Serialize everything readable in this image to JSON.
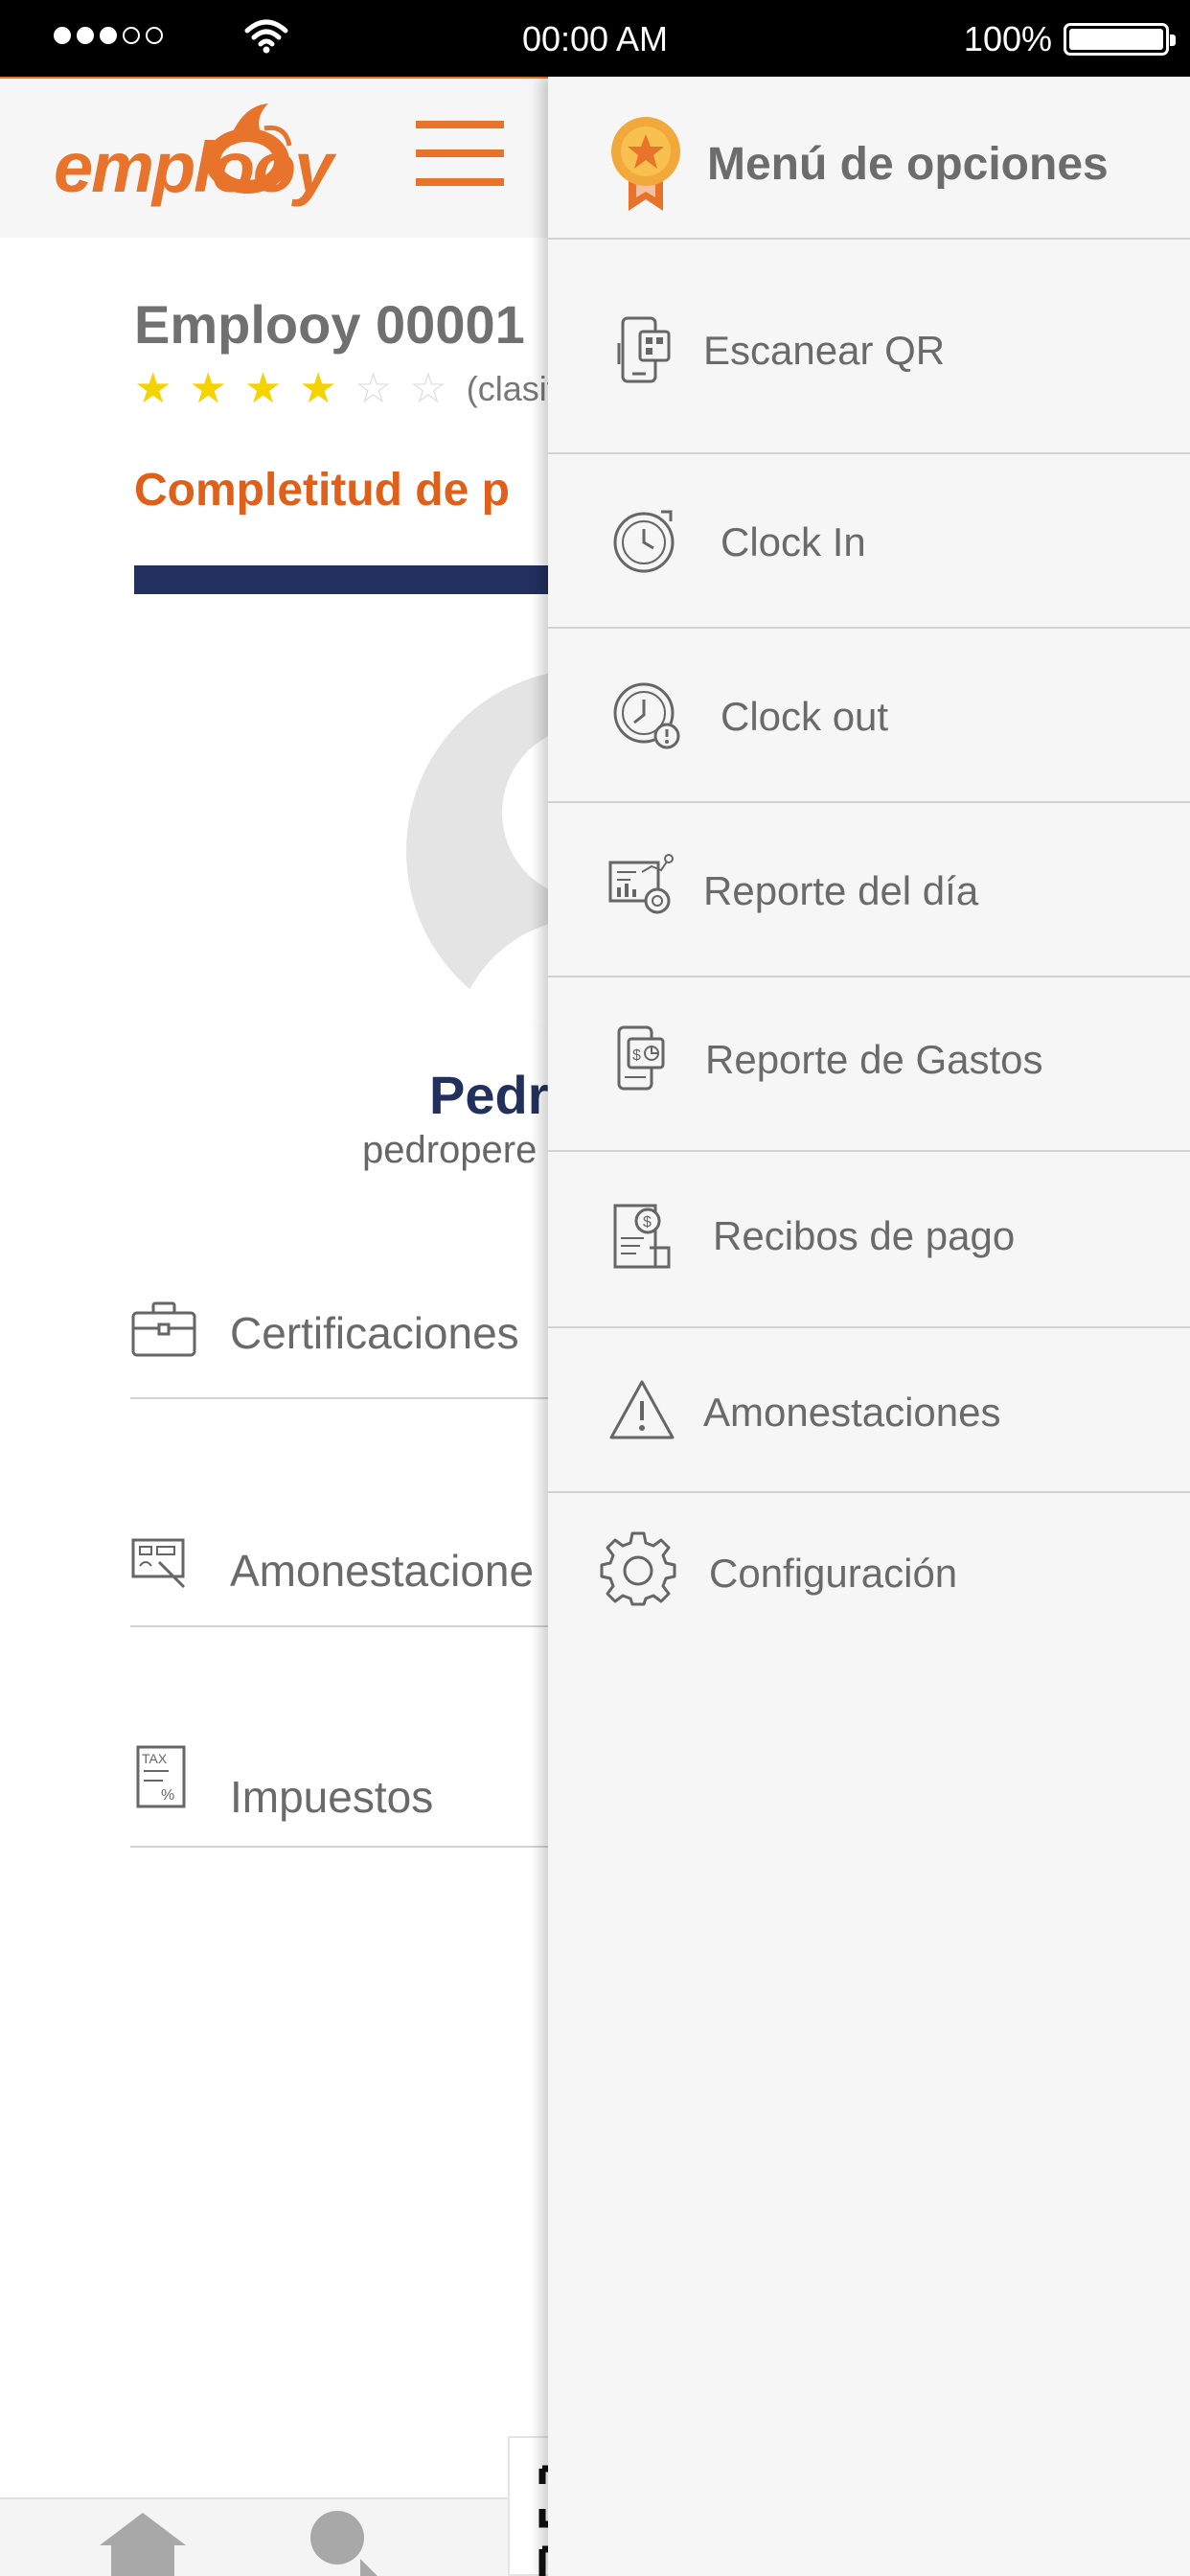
{
  "status_bar": {
    "time": "00:00 AM",
    "battery": "100%"
  },
  "app": {
    "logo_text": "emplooy",
    "colors": {
      "accent": "#e8732a",
      "navy": "#22305e",
      "star": "#f5d300"
    }
  },
  "profile": {
    "title": "Emplooy 00001",
    "rating": 4,
    "rating_max": 6,
    "rating_label": "(clasifi",
    "completeness_label": "Completitud de p",
    "completeness_fraction": 1,
    "name": "Pedr",
    "email": "pedropere",
    "sections": [
      {
        "label": "Certificaciones",
        "icon": "briefcase-icon"
      },
      {
        "label": "Amonestacione",
        "icon": "whiteboard-icon"
      },
      {
        "label": "Impuestos",
        "icon": "tax-document-icon"
      }
    ]
  },
  "drawer": {
    "title": "Menú de opciones",
    "icon": "medal-icon",
    "items": [
      {
        "label": "Escanear QR",
        "icon": "qr-scan-phone-icon"
      },
      {
        "label": "Clock In",
        "icon": "clock-in-icon"
      },
      {
        "label": "Clock out",
        "icon": "clock-out-icon"
      },
      {
        "label": "Reporte del día",
        "icon": "daily-report-icon"
      },
      {
        "label": "Reporte de Gastos",
        "icon": "expense-report-icon"
      },
      {
        "label": "Recibos de pago",
        "icon": "pay-receipt-icon"
      },
      {
        "label": "Amonestaciones",
        "icon": "warning-icon"
      },
      {
        "label": "Configuración",
        "icon": "gear-icon"
      }
    ]
  }
}
